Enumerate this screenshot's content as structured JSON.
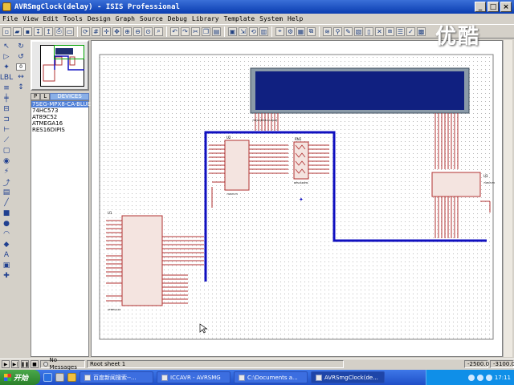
{
  "window": {
    "title": "AVRSmgClock(delay) - ISIS Professional"
  },
  "menu": [
    "File",
    "View",
    "Edit",
    "Tools",
    "Design",
    "Graph",
    "Source",
    "Debug",
    "Library",
    "Template",
    "System",
    "Help"
  ],
  "watermark": "优酷",
  "devices": {
    "tab_p": "P",
    "tab_l": "L",
    "header": "DEVICES",
    "items": [
      "7SEG-MPX8-CA-BLUE",
      "74HC573",
      "AT89C52",
      "ATMEGA16",
      "RES16DIPIS"
    ],
    "selected_index": 0
  },
  "schematic": {
    "mcu_ref": "U1",
    "mcu_part": "ATMEGA16",
    "latch_u2_ref": "U2",
    "latch_u2_part": "74HC573",
    "latch_u3_ref": "U3",
    "latch_u3_part": "74HC573",
    "rn_ref": "RN1",
    "rn_part": "RES16DIPIS",
    "display_part": "7SEG-MPX8-CA-BLUE",
    "bus_color": "#1010c0",
    "display_color": "#102080",
    "part_color": "#b03030"
  },
  "status": {
    "message": "No Messages",
    "sheet": "Root sheet 1",
    "coord_x": "-2500.0",
    "coord_y": "-3100.0"
  },
  "taskbar": {
    "start": "开始",
    "tasks": [
      "百度新闻搜索--...",
      "ICCAVR - AVRSMG",
      "C:\\Documents a...",
      "AVRSmgClock(de..."
    ],
    "active_index": 3,
    "clock": "17:11"
  }
}
